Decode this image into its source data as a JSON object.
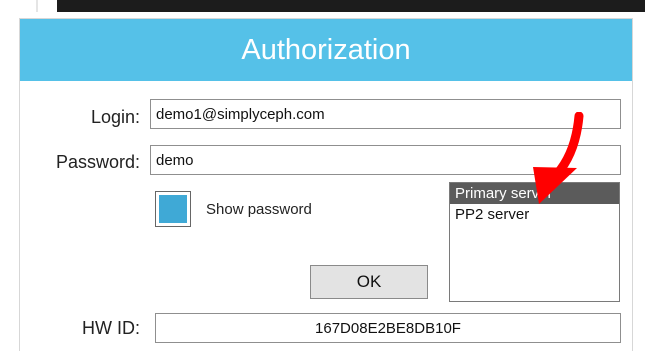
{
  "dialog": {
    "title": "Authorization"
  },
  "form": {
    "login_label": "Login:",
    "login_value": "demo1@simplyceph.com",
    "password_label": "Password:",
    "password_value": "demo",
    "show_password_label": "Show password",
    "show_password_checked": true,
    "ok_label": "OK",
    "hwid_label": "HW ID:",
    "hwid_value": "167D08E2BE8DB10F"
  },
  "servers": {
    "items": [
      {
        "label": "Primary server",
        "selected": true
      },
      {
        "label": "PP2 server",
        "selected": false
      }
    ]
  },
  "colors": {
    "title_bar": "#55c1e8",
    "checkbox_fill": "#3fa9d6",
    "selected_item": "#5b5b5b",
    "annotation_arrow": "#ff0000"
  },
  "icons": {
    "annotation": "red-arrow-icon"
  }
}
